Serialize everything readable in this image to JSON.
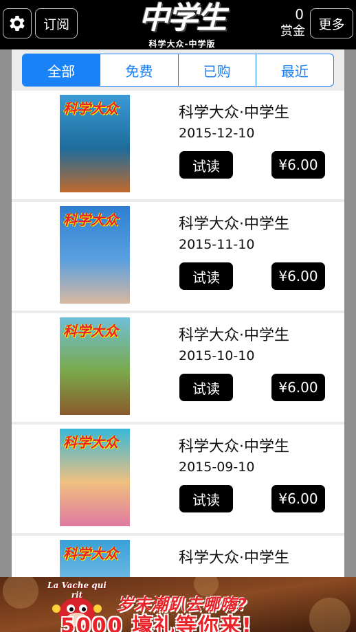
{
  "header": {
    "subscribe_label": "订阅",
    "more_label": "更多",
    "logo_title": "中学生",
    "logo_subtitle": "科学大众-中学版",
    "reward_count": "0",
    "reward_label": "赏金"
  },
  "tabs": [
    {
      "label": "全部",
      "active": true
    },
    {
      "label": "免费",
      "active": false
    },
    {
      "label": "已购",
      "active": false
    },
    {
      "label": "最近",
      "active": false
    }
  ],
  "issues": [
    {
      "title": "科学大众·中学生",
      "date": "2015-12-10",
      "trial_label": "试读",
      "price": "¥6.00",
      "cover_title": "科学大众",
      "cover_colors": [
        "#3b9ad6",
        "#1e6c9c",
        "#c06a2c"
      ]
    },
    {
      "title": "科学大众·中学生",
      "date": "2015-11-10",
      "trial_label": "试读",
      "price": "¥6.00",
      "cover_title": "科学大众",
      "cover_colors": [
        "#2f7fd1",
        "#5aa0e0",
        "#d9b8a0"
      ]
    },
    {
      "title": "科学大众·中学生",
      "date": "2015-10-10",
      "trial_label": "试读",
      "price": "¥6.00",
      "cover_title": "科学大众",
      "cover_colors": [
        "#6fbfd8",
        "#7aa94a",
        "#8a5a2c"
      ]
    },
    {
      "title": "科学大众·中学生",
      "date": "2015-09-10",
      "trial_label": "试读",
      "price": "¥6.00",
      "cover_title": "科学大众",
      "cover_colors": [
        "#38b8d8",
        "#f0c080",
        "#e07aa0"
      ]
    },
    {
      "title": "科学大众·中学生",
      "date": "",
      "trial_label": "",
      "price": "",
      "cover_title": "科学大众",
      "cover_colors": [
        "#3aa0d8",
        "#7fc0e8",
        "#c0d8e8"
      ]
    }
  ],
  "ad": {
    "brand": "La Vache qui rit",
    "line1": "岁末潮趴去哪嗨?",
    "line2": "5000 壕礼等你来!"
  },
  "colors": {
    "accent": "#1a82f7",
    "topbar": "#000000",
    "panel_bg": "#ececec",
    "ad_red": "#e8232a"
  },
  "icons": {
    "settings": "gear-icon"
  }
}
